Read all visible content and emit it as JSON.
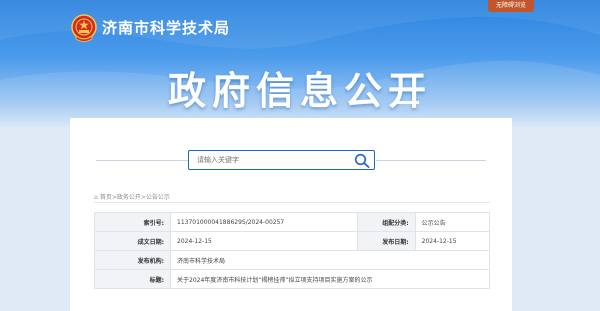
{
  "header": {
    "top_link": "无障碍浏览",
    "site_name": "济南市科学技术局",
    "hero_title": "政府信息公开"
  },
  "search": {
    "placeholder": "请输入关键字"
  },
  "breadcrumb": {
    "items": [
      "首页",
      "政务公开",
      "公告公示"
    ],
    "separator": ">"
  },
  "meta": {
    "index_label": "索引号:",
    "index_value": "11370100004188629S/2024-00257",
    "category_label": "组配分类:",
    "category_value": "公示公告",
    "created_label": "成文日期:",
    "created_value": "2024-12-15",
    "published_label": "发布日期:",
    "published_value": "2024-12-15",
    "publisher_label": "发布机构:",
    "publisher_value": "济南市科学技术局",
    "title_label": "标题:",
    "title_value": "关于2024年度济南市科技计划“揭榜挂帅”拟立项支持项目实施方案的公示"
  },
  "colors": {
    "brand_blue": "#2a82de",
    "accent_orange": "#c3552b",
    "search_border": "#1f66c2"
  }
}
